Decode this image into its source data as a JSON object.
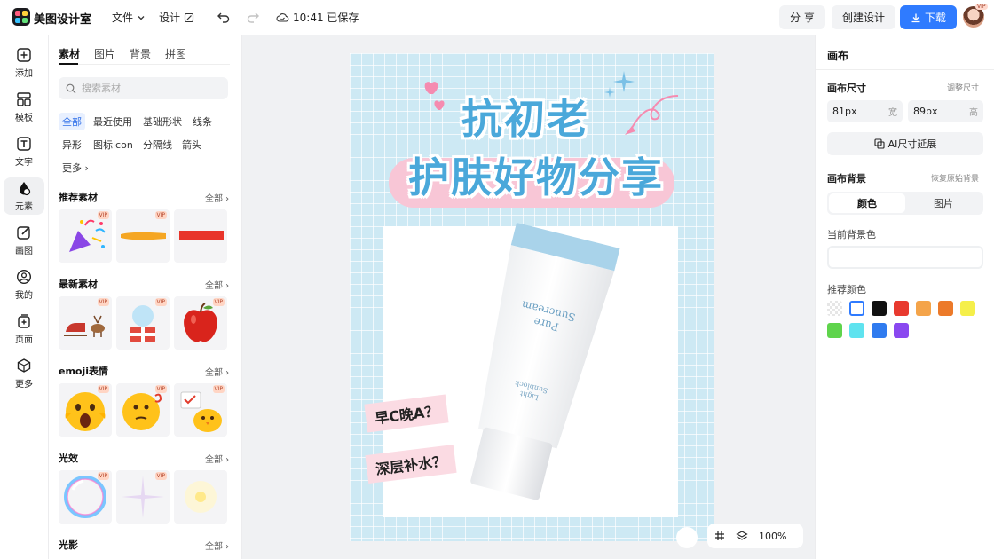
{
  "app": {
    "name": "美图设计室"
  },
  "menu": {
    "file": "文件",
    "design": "设计"
  },
  "save_status": "10:41 已保存",
  "actions": {
    "share": "分 享",
    "create": "创建设计",
    "download": "下载",
    "avatar_badge": "VIP"
  },
  "rail": [
    {
      "label": "添加",
      "icon": "plus-square-icon"
    },
    {
      "label": "模板",
      "icon": "template-grid-icon"
    },
    {
      "label": "文字",
      "icon": "text-icon"
    },
    {
      "label": "元素",
      "icon": "shapes-icon"
    },
    {
      "label": "画图",
      "icon": "edit-icon"
    },
    {
      "label": "我的",
      "icon": "user-icon"
    },
    {
      "label": "页面",
      "icon": "add-page-icon"
    },
    {
      "label": "更多",
      "icon": "cube-icon"
    }
  ],
  "rail_active": "元素",
  "panel": {
    "tabs": [
      "素材",
      "图片",
      "背景",
      "拼图"
    ],
    "active_tab": "素材",
    "search_placeholder": "搜索素材",
    "chips": [
      "全部",
      "最近使用",
      "基础形状",
      "线条",
      "异形",
      "图标icon",
      "分隔线",
      "箭头",
      "更多"
    ],
    "active_chip": "全部",
    "sections": [
      {
        "title": "推荐素材",
        "more": "全部"
      },
      {
        "title": "最新素材",
        "more": "全部"
      },
      {
        "title": "emoji表情",
        "more": "全部"
      },
      {
        "title": "光效",
        "more": "全部"
      },
      {
        "title": "光影",
        "more": "全部"
      }
    ],
    "vip": "VIP"
  },
  "canvas": {
    "headline_1": "抗初老",
    "headline_2": "护肤好物分享",
    "tube_brand": "Pure Suncream",
    "tube_sub": "Light Sunblock",
    "sticker_1": "早C晚A？",
    "sticker_2": "深层补水？",
    "zoom": "100%"
  },
  "right_panel": {
    "title": "画布",
    "size_label": "画布尺寸",
    "resize_link": "调整尺寸",
    "width_value": "81px",
    "width_unit": "宽",
    "height_value": "89px",
    "height_unit": "高",
    "ai_extend": "AI尺寸延展",
    "bg_label": "画布背景",
    "restore_link": "恢复原始背景",
    "bg_tabs": [
      "颜色",
      "图片"
    ],
    "bg_active": "颜色",
    "current_bg_label": "当前背景色",
    "recommend_label": "推荐颜色",
    "swatches": [
      "transparent",
      "#ffffff",
      "#111111",
      "#e83a2f",
      "#f4a44a",
      "#ec7a2a",
      "#f5ef4a",
      "#5fd44c",
      "#5fe3ef",
      "#2f7bef",
      "#8a48f0"
    ]
  }
}
